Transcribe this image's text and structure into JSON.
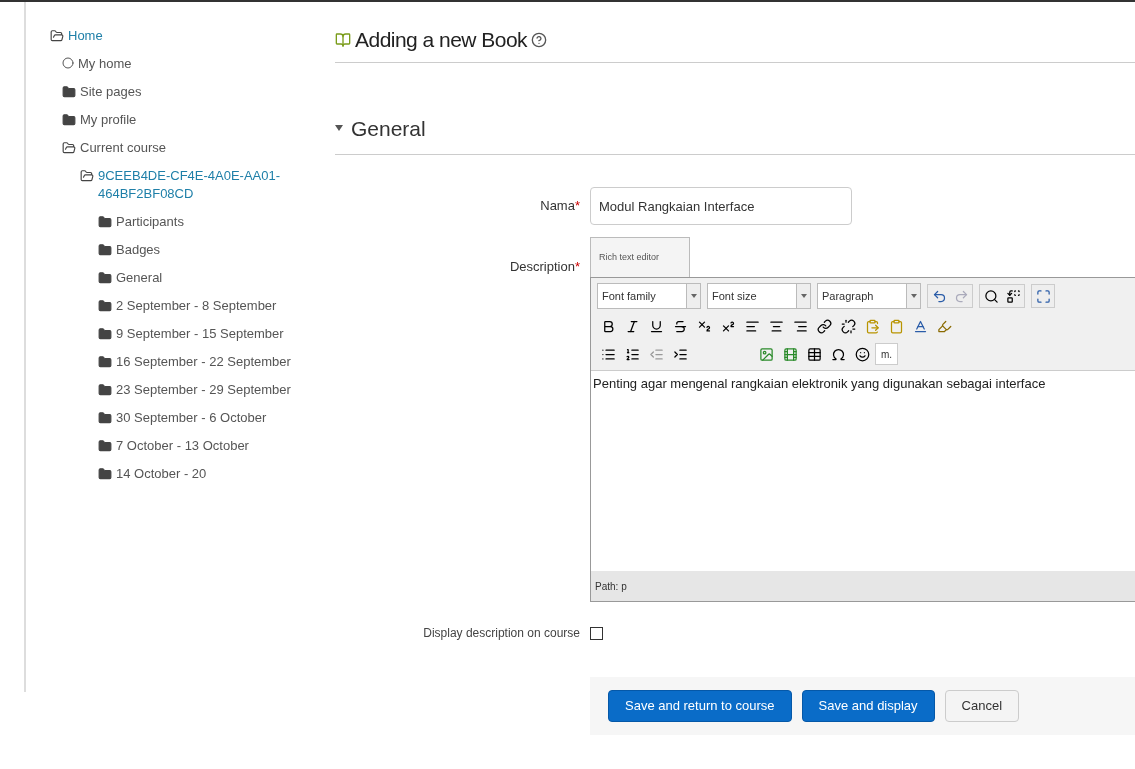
{
  "sidebar": {
    "items": [
      {
        "label": "Home",
        "kind": "link",
        "expanded": true,
        "children": [
          {
            "label": "My home",
            "kind": "page",
            "expanded": false
          },
          {
            "label": "Site pages",
            "kind": "branch",
            "expanded": false
          },
          {
            "label": "My profile",
            "kind": "branch",
            "expanded": false
          },
          {
            "label": "Current course",
            "kind": "branch",
            "expanded": true,
            "children": [
              {
                "label": "9CEEB4DE-CF4E-4A0E-AA01-464BF2BF08CD",
                "kind": "link",
                "expanded": true,
                "children": [
                  {
                    "label": "Participants",
                    "kind": "branch",
                    "expanded": false
                  },
                  {
                    "label": "Badges",
                    "kind": "branch",
                    "expanded": false
                  },
                  {
                    "label": "General",
                    "kind": "branch",
                    "expanded": false
                  },
                  {
                    "label": "2 September - 8 September",
                    "kind": "branch",
                    "expanded": false
                  },
                  {
                    "label": "9 September - 15 September",
                    "kind": "branch",
                    "expanded": false
                  },
                  {
                    "label": "16 September - 22 September",
                    "kind": "branch",
                    "expanded": false
                  },
                  {
                    "label": "23 September - 29 September",
                    "kind": "branch",
                    "expanded": false
                  },
                  {
                    "label": "30 September - 6 October",
                    "kind": "branch",
                    "expanded": false
                  },
                  {
                    "label": "7 October - 13 October",
                    "kind": "branch",
                    "expanded": false
                  },
                  {
                    "label": "14 October - 20",
                    "kind": "branch",
                    "expanded": false
                  }
                ]
              }
            ]
          }
        ]
      }
    ]
  },
  "page_title": "Adding a new Book",
  "section": {
    "title": "General",
    "expanded": true
  },
  "name_field": {
    "label": "Nama",
    "required_mark": "*",
    "value": "Modul Rangkaian Interface"
  },
  "description": {
    "label": "Description",
    "required_mark": "*",
    "editor_tab": "Rich text editor",
    "dropdowns": [
      "Font family",
      "Font size",
      "Paragraph"
    ],
    "toolbar_text_button": "m.",
    "text": "Penting agar mengenal rangkaian elektronik yang digunakan sebagai interface",
    "path": "Path: p"
  },
  "display_on_course": {
    "label": "Display description on course",
    "checked": false
  },
  "buttons": [
    {
      "label": "Save and return to course",
      "kind": "primary"
    },
    {
      "label": "Save and display",
      "kind": "primary"
    },
    {
      "label": "Cancel",
      "kind": "secondary"
    }
  ]
}
